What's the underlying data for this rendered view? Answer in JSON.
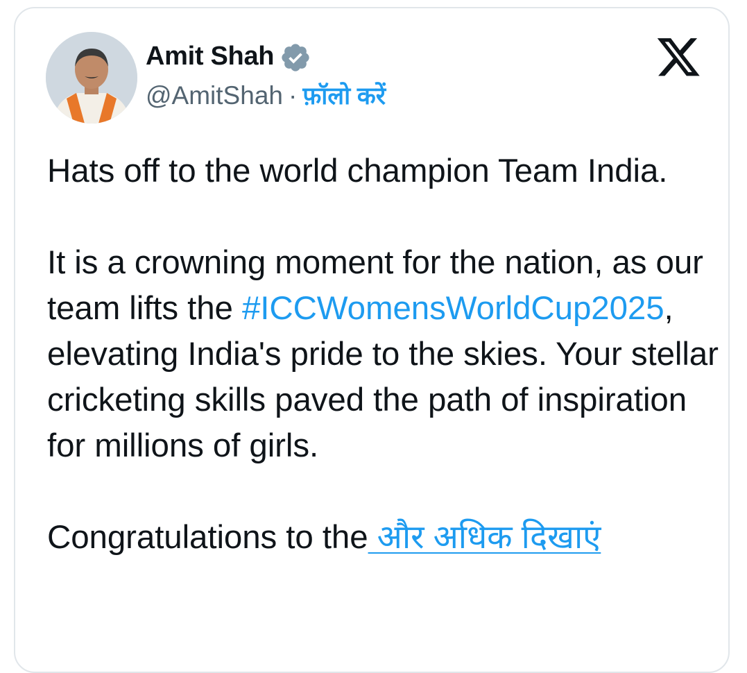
{
  "author": {
    "name": "Amit Shah",
    "handle": "@AmitShah",
    "separator": "·",
    "follow_label": "फ़ॉलो करें",
    "verified_icon": "verified-badge-icon",
    "avatar_icon": "profile-photo"
  },
  "platform": {
    "logo_icon": "x-logo-icon"
  },
  "tweet": {
    "line1": "Hats off to the world champion Team India.",
    "para2_start": "It is a crowning moment for the nation, as our team lifts the ",
    "hashtag": "#ICCWomensWorldCup2025",
    "para2_end": ", elevating India's pride to the skies. Your stellar cricketing skills paved the path of inspiration for millions of girls.",
    "para3_start": "Congratulations to the",
    "show_more": " और अधिक दिखाएं"
  },
  "colors": {
    "link": "#1d9bf0",
    "text": "#0f1419",
    "muted": "#536471",
    "border": "#e1e6ea"
  }
}
